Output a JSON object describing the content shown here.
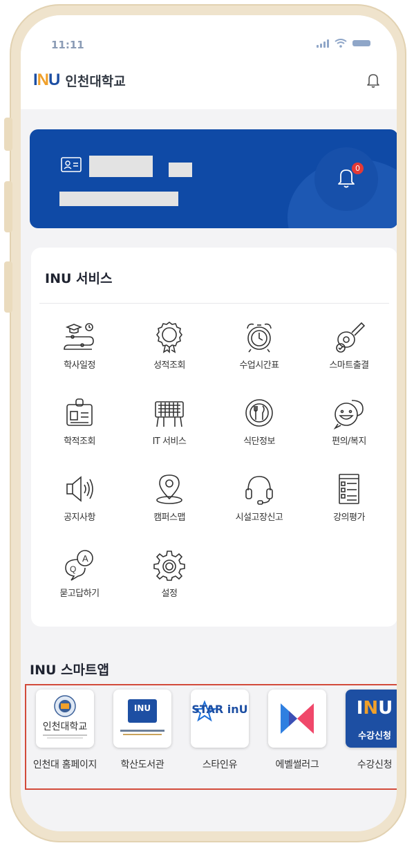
{
  "status_bar": {
    "time": "11:11"
  },
  "header": {
    "logo_text": "인천대학교",
    "logo_mark": [
      "I",
      "N",
      "U"
    ]
  },
  "services": {
    "title": "INU 서비스",
    "items": [
      {
        "label": "학사일정",
        "icon": "academic-calendar-icon"
      },
      {
        "label": "성적조회",
        "icon": "award-ribbon-icon"
      },
      {
        "label": "수업시간표",
        "icon": "alarm-clock-icon"
      },
      {
        "label": "스마트출결",
        "icon": "guitar-check-icon"
      },
      {
        "label": "학적조회",
        "icon": "id-badge-icon"
      },
      {
        "label": "IT 서비스",
        "icon": "keyboard-hands-icon"
      },
      {
        "label": "식단정보",
        "icon": "plate-cutlery-icon"
      },
      {
        "label": "편의/복지",
        "icon": "smile-chat-icon"
      },
      {
        "label": "공지사항",
        "icon": "speaker-icon"
      },
      {
        "label": "캠퍼스맵",
        "icon": "map-pin-icon"
      },
      {
        "label": "시설고장신고",
        "icon": "headset-icon"
      },
      {
        "label": "강의평가",
        "icon": "checklist-icon"
      },
      {
        "label": "묻고답하기",
        "icon": "qa-chat-icon"
      },
      {
        "label": "설정",
        "icon": "gear-icon"
      }
    ]
  },
  "notification_badge": "0",
  "smart_apps": {
    "title": "INU 스마트앱",
    "items": [
      {
        "label": "인천대 홈페이지",
        "icon_text": "인천대학교"
      },
      {
        "label": "학산도서관",
        "icon_text": "INU"
      },
      {
        "label": "스타인유",
        "icon_text": "STAR inU"
      },
      {
        "label": "에벨썰러그",
        "icon_text": ""
      },
      {
        "label": "수강신청",
        "icon_text": "수강신청"
      }
    ]
  },
  "colors": {
    "primary": "#0f4aa6",
    "accent": "#f0a02a",
    "highlight_border": "#d24a3a"
  }
}
